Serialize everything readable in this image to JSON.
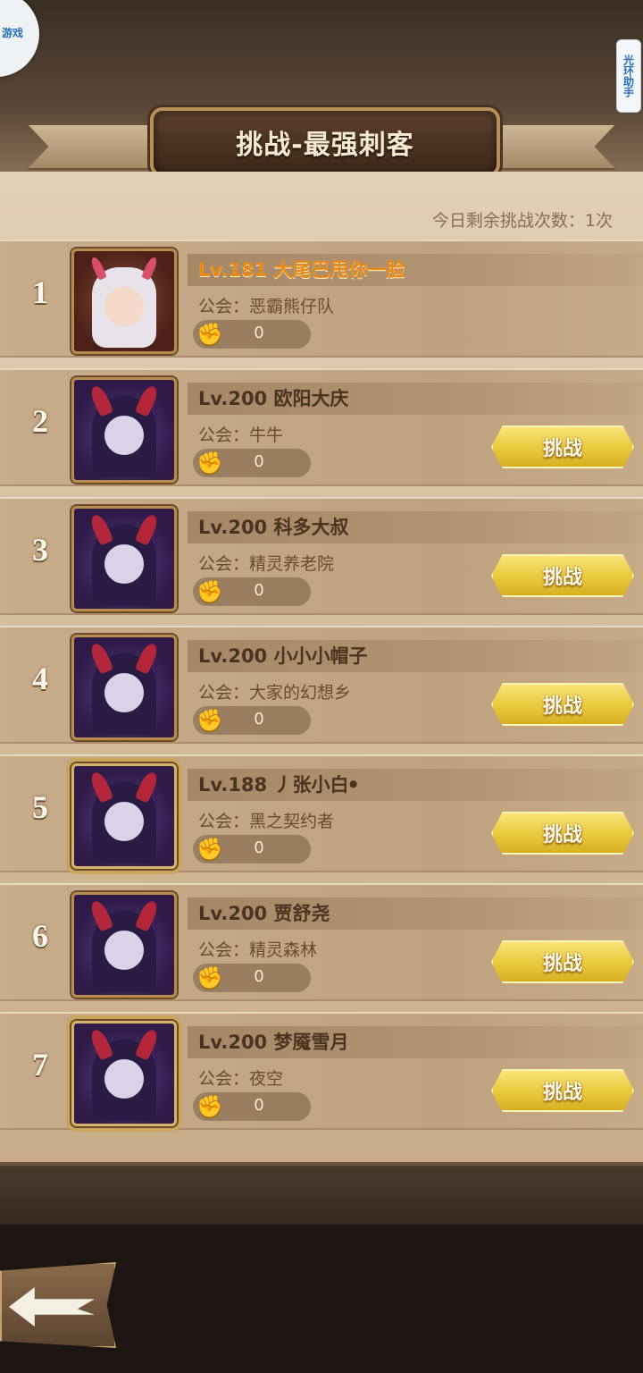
{
  "app": {
    "title": "挑战-最强刺客",
    "assistant_label": "光环助手",
    "corner_logo": "游戏"
  },
  "header": {
    "remaining_text": "今日剩余挑战次数：1次"
  },
  "entries": [
    {
      "rank": "1",
      "name": "Lv.181 大尾巴甩你一脸",
      "guild": "公会：恶霸熊仔队",
      "power": "0",
      "is_self": true,
      "challenge": ""
    },
    {
      "rank": "2",
      "name": "Lv.200 欧阳大庆",
      "guild": "公会：牛牛",
      "power": "0",
      "is_self": false,
      "challenge": "挑战"
    },
    {
      "rank": "3",
      "name": "Lv.200 科多大叔",
      "guild": "公会：精灵养老院",
      "power": "0",
      "is_self": false,
      "challenge": "挑战"
    },
    {
      "rank": "4",
      "name": "Lv.200 小小小帽子",
      "guild": "公会：大家的幻想乡",
      "power": "0",
      "is_self": false,
      "challenge": "挑战"
    },
    {
      "rank": "5",
      "name": "Lv.188 丿张小白ꔷ",
      "guild": "公会：黑之契约者",
      "power": "0",
      "is_self": false,
      "challenge": "挑战"
    },
    {
      "rank": "6",
      "name": "Lv.200 贾舒尧",
      "guild": "公会：精灵森林",
      "power": "0",
      "is_self": false,
      "challenge": "挑战"
    },
    {
      "rank": "7",
      "name": "Lv.200 梦魇雪月",
      "guild": "公会：夜空",
      "power": "0",
      "is_self": false,
      "challenge": "挑战"
    }
  ],
  "icons": {
    "power": "fist-icon",
    "back": "back-arrow-icon"
  },
  "colors": {
    "self_name": "#e98a12",
    "button": "#e9c83a"
  }
}
